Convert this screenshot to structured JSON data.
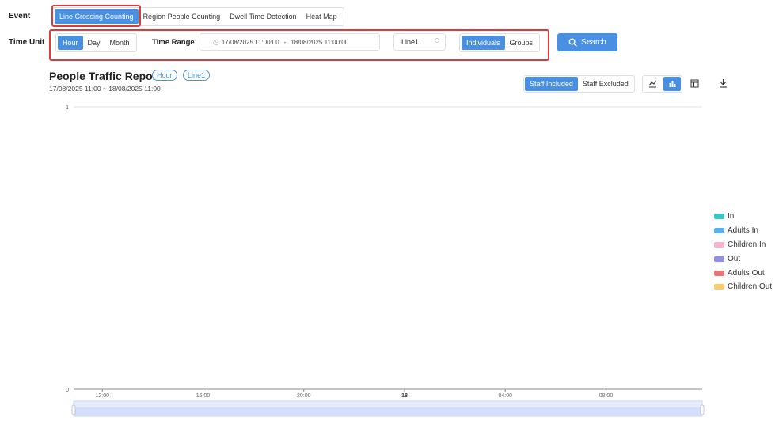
{
  "filters": {
    "event_label": "Event",
    "event_options": [
      "Line Crossing Counting",
      "Region People Counting",
      "Dwell Time Detection",
      "Heat Map"
    ],
    "time_unit_label": "Time Unit",
    "time_units": [
      "Hour",
      "Day",
      "Month"
    ],
    "time_range_label": "Time Range",
    "range_start": "17/08/2025 11:00:00",
    "range_separator": "-",
    "range_end": "18/08/2025 11:00:00",
    "line_select": "Line1",
    "count_modes": [
      "Individuals",
      "Groups"
    ],
    "search_label": "Search"
  },
  "report": {
    "title": "People Traffic Report",
    "tag_unit": "Hour",
    "tag_line": "Line1",
    "subtitle": "17/08/2025 11:00 ~ 18/08/2025 11:00",
    "staff_options": [
      "Staff Included",
      "Staff Excluded"
    ]
  },
  "chart_data": {
    "type": "bar",
    "x_tick_labels": [
      "12:00",
      "16:00",
      "20:00",
      "18",
      "04:00",
      "08:00"
    ],
    "y_tick_labels": [
      "0",
      "1"
    ],
    "ylim": [
      0,
      1
    ],
    "series": [
      {
        "name": "In",
        "color": "#3ac5c7",
        "values": []
      },
      {
        "name": "Adults In",
        "color": "#5ab1ef",
        "values": []
      },
      {
        "name": "Children In",
        "color": "#f8b2d1",
        "values": []
      },
      {
        "name": "Out",
        "color": "#8f8fe8",
        "values": []
      },
      {
        "name": "Adults Out",
        "color": "#ec7676",
        "values": []
      },
      {
        "name": "Children Out",
        "color": "#fcca6b",
        "values": []
      }
    ],
    "grid": true,
    "legend_position": "right"
  }
}
